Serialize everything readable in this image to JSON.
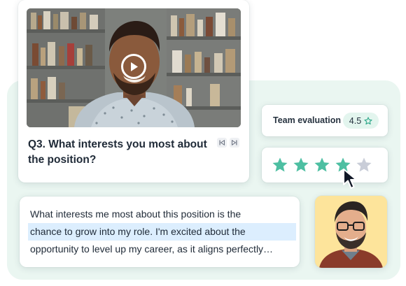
{
  "video": {
    "question": "Q3. What interests you most about the position?",
    "play_icon": "play-icon",
    "prev_icon": "skip-back-icon",
    "next_icon": "skip-forward-icon"
  },
  "evaluation": {
    "label": "Team evaluation",
    "score": "4.5",
    "star_icon": "star-outline-icon"
  },
  "rating": {
    "value": 4,
    "max": 5,
    "filled_color": "#4dbfa2",
    "empty_color": "#c9cdd8"
  },
  "answer": {
    "line1": "What interests me most about this position is the",
    "line2": "chance to grow into my role. I'm excited about the",
    "line3": "opportunity to level up my career, as it aligns perfectly…"
  },
  "colors": {
    "accent": "#4dbfa2",
    "panel_bg": "#eaf6f1",
    "highlight": "#dceefe",
    "avatar_bg": "#fde49b"
  }
}
